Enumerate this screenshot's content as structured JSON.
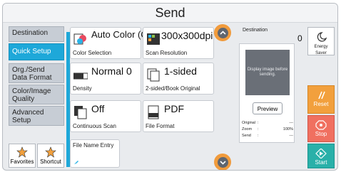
{
  "header": {
    "title": "Send"
  },
  "nav": {
    "items": [
      {
        "label": "Destination"
      },
      {
        "label": "Quick Setup"
      },
      {
        "label": "Org./Send Data Format"
      },
      {
        "label": "Color/Image Quality"
      },
      {
        "label": "Advanced Setup"
      }
    ],
    "favorites_label": "Favorites",
    "shortcut_label": "Shortcut"
  },
  "tiles": [
    {
      "value": "Auto Color (Col./Gray)",
      "label": "Color Selection",
      "icon": "color-selection-icon"
    },
    {
      "value": "300x300dpi",
      "label": "Scan Resolution",
      "icon": "dpi-icon"
    },
    {
      "value": "Normal 0",
      "label": "Density",
      "icon": "density-icon"
    },
    {
      "value": "1-sided",
      "label": "2-sided/Book Original",
      "icon": "page-icon"
    },
    {
      "value": "Off",
      "label": "Continuous Scan",
      "icon": "continuous-scan-icon"
    },
    {
      "value": "PDF",
      "label": "File Format",
      "icon": "pdf-icon"
    },
    {
      "value": "",
      "label": "File Name Entry",
      "icon": "file-name-icon"
    }
  ],
  "destination": {
    "label": "Destination",
    "count": "0"
  },
  "preview": {
    "placeholder": "Display image before sending.",
    "button_label": "Preview",
    "rows": [
      {
        "key": "Original",
        "value": "---"
      },
      {
        "key": "Zoom",
        "value": "100%"
      },
      {
        "key": "Send",
        "value": "---"
      }
    ]
  },
  "actions": {
    "energy_saver": "Energy Saver",
    "reset": "Reset",
    "stop": "Stop",
    "start": "Start"
  },
  "colors": {
    "nav_active": "#1ea8d9",
    "scroll_button": "#f19b3c",
    "reset": "#f2a03d",
    "stop": "#f07060",
    "start": "#29b0a9"
  }
}
